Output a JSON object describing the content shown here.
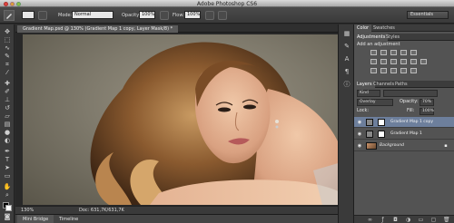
{
  "window": {
    "title": "Adobe Photoshop CS6"
  },
  "options_bar": {
    "mode_label": "Mode:",
    "mode_value": "Normal",
    "opacity_label": "Opacity:",
    "opacity_value": "100%",
    "flow_label": "Flow:",
    "flow_value": "100%",
    "workspace": "Essentials"
  },
  "document": {
    "tab_title": "Gradient Map.psd @ 130% (Gradient Map 1 copy, Layer Mask/8) *",
    "zoom": "130%",
    "doc_info": "Doc: 631,7K/631,7K"
  },
  "bottom_tabs": [
    "Mini Bridge",
    "Timeline"
  ],
  "panels": {
    "top_tabs": [
      "Color",
      "Swatches"
    ],
    "adj_tabs": [
      "Adjustments",
      "Styles"
    ],
    "add_adjustment": "Add an adjustment",
    "layer_tabs": [
      "Layers",
      "Channels",
      "Paths"
    ],
    "kind": "Kind",
    "blend_mode": "Overlay",
    "opacity_label": "Opacity:",
    "opacity_value": "70%",
    "lock_label": "Lock:",
    "fill_label": "Fill:",
    "fill_value": "100%",
    "layers": [
      {
        "name": "Gradient Map 1 copy"
      },
      {
        "name": "Gradient Map 1"
      },
      {
        "name": "Background"
      }
    ]
  },
  "colors": {
    "selected_layer": "#6d7f9c",
    "panel_bg": "#535353",
    "workspace_bg": "#282828"
  },
  "icons": {
    "tools": [
      "move-icon",
      "marquee-icon",
      "lasso-icon",
      "quick-select-icon",
      "crop-icon",
      "eyedropper-icon",
      "healing-icon",
      "brush-icon",
      "clone-stamp-icon",
      "history-brush-icon",
      "eraser-icon",
      "gradient-icon",
      "blur-icon",
      "dodge-icon",
      "pen-icon",
      "type-icon",
      "path-select-icon",
      "shape-icon",
      "hand-icon",
      "zoom-icon"
    ]
  }
}
